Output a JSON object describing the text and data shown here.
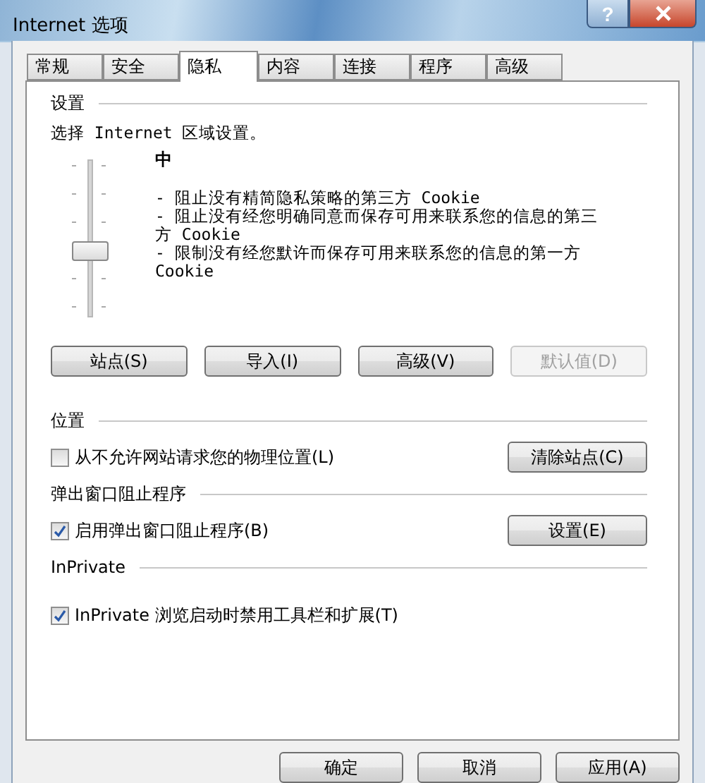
{
  "window": {
    "title": "Internet 选项",
    "help": "?"
  },
  "tabs": [
    {
      "label": "常规",
      "selected": false
    },
    {
      "label": "安全",
      "selected": false
    },
    {
      "label": "隐私",
      "selected": true
    },
    {
      "label": "内容",
      "selected": false
    },
    {
      "label": "连接",
      "selected": false
    },
    {
      "label": "程序",
      "selected": false
    },
    {
      "label": "高级",
      "selected": false
    }
  ],
  "settings": {
    "heading": "设置",
    "prompt": "选择 Internet 区域设置。",
    "slider": {
      "level": 0.4
    },
    "level_name": "中",
    "description": [
      "- 阻止没有精简隐私策略的第三方 Cookie",
      "- 阻止没有经您明确同意而保存可用来联系您的信息的第三方 Cookie",
      "- 限制没有经您默许而保存可用来联系您的信息的第一方 Cookie"
    ],
    "buttons": [
      {
        "label": "站点(S)",
        "disabled": false
      },
      {
        "label": "导入(I)",
        "disabled": false
      },
      {
        "label": "高级(V)",
        "disabled": false
      },
      {
        "label": "默认值(D)",
        "disabled": true
      }
    ]
  },
  "sections": [
    {
      "heading": "位置",
      "option": {
        "label": "从不允许网站请求您的物理位置(L)",
        "checked": false
      },
      "button": "清除站点(C)"
    },
    {
      "heading": "弹出窗口阻止程序",
      "option": {
        "label": "启用弹出窗口阻止程序(B)",
        "checked": true
      },
      "button": "设置(E)"
    },
    {
      "heading": "InPrivate",
      "option": {
        "label": "InPrivate 浏览启动时禁用工具栏和扩展(T)",
        "checked": true
      }
    }
  ],
  "footer_buttons": [
    "确定",
    "取消",
    "应用(A)"
  ]
}
